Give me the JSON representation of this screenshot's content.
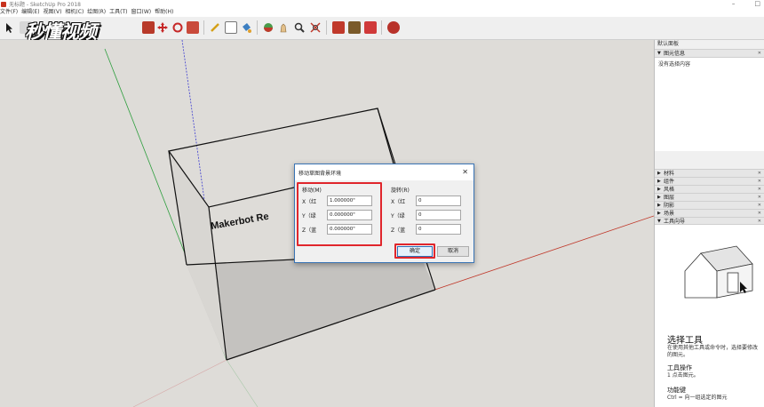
{
  "window": {
    "title": "无标题 - SketchUp Pro 2018",
    "minimize": "–",
    "maximize": "□"
  },
  "menu": [
    "文件(F)",
    "编辑(E)",
    "视图(V)",
    "相机(C)",
    "绘图(R)",
    "工具(T)",
    "窗口(W)",
    "帮助(H)"
  ],
  "watermark": "秒懂视频",
  "model": {
    "label": "Makerbot Re"
  },
  "tray": {
    "title": "默认面板",
    "entity_info": {
      "header": "图元信息",
      "content": "没有选择内容"
    },
    "panels": [
      "材料",
      "组件",
      "风格",
      "图层",
      "阴影",
      "场景"
    ],
    "instructor": {
      "header": "工具向导",
      "heading": "选择工具",
      "desc": "在使用其他工具或命令时，选择要修改的图元。",
      "ops_title": "工具操作",
      "ops_1": "1 点击图元。",
      "keys_title": "功能键",
      "keys_1": "Ctrl = 向一组选定的图元"
    }
  },
  "dialog": {
    "title": "移动草图背景环境",
    "close": "✕",
    "move": {
      "label": "移动(M)",
      "x_label": "X（红",
      "y_label": "Y（绿",
      "z_label": "Z（蓝",
      "x": "1.000000\"",
      "y": "0.000000\"",
      "z": "0.000000\""
    },
    "rotate": {
      "label": "旋转(R)",
      "x_label": "X（红",
      "y_label": "Y（绿",
      "z_label": "Z（蓝",
      "x": "0",
      "y": "0",
      "z": "0"
    },
    "ok": "确定",
    "cancel": "取消"
  },
  "colors": {
    "accent_red": "#e0262c",
    "axis_red": "#c0392b",
    "axis_green": "#2e9e3e",
    "axis_blue": "#3b3bd0"
  }
}
